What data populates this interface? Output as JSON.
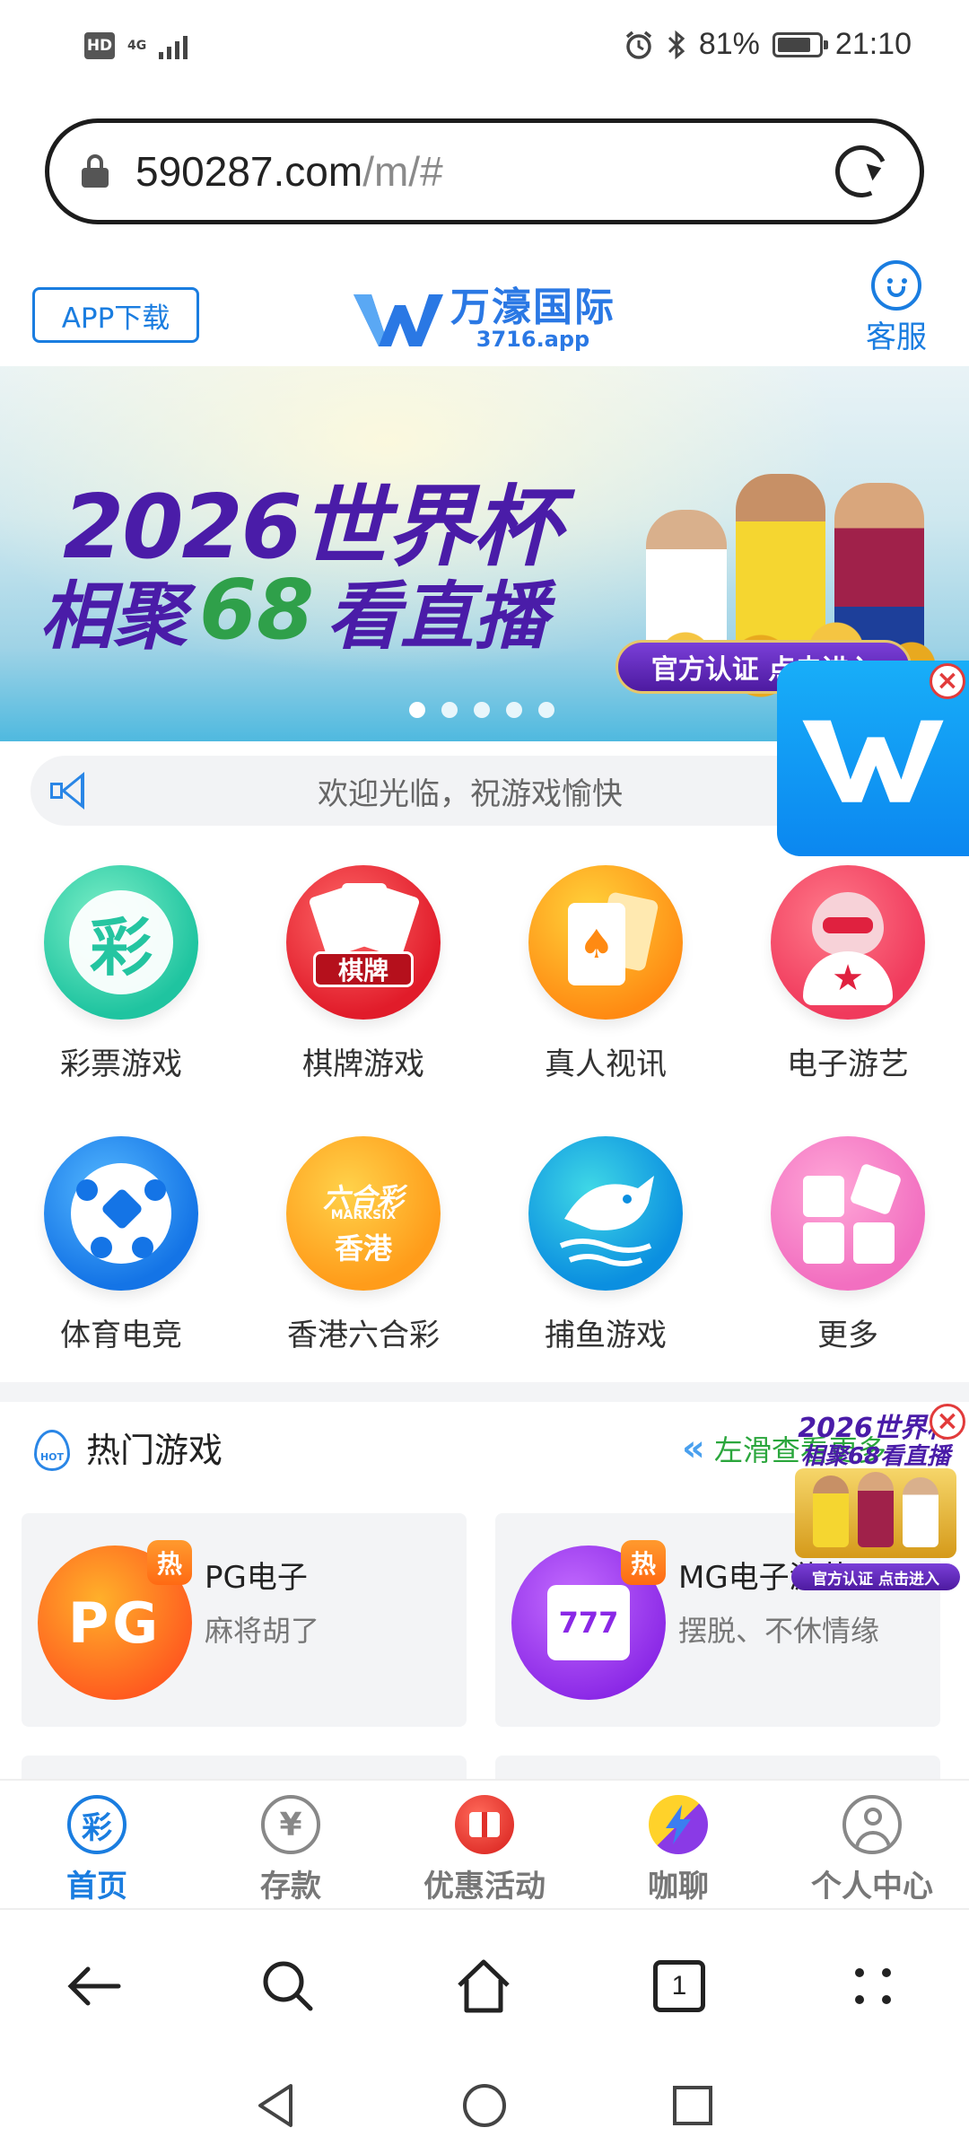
{
  "status_bar": {
    "hd": "HD",
    "network": "4G",
    "battery": "81%",
    "battery_level": 0.81,
    "time": "21:10"
  },
  "url_bar": {
    "domain": "590287.com",
    "path": "/m/#"
  },
  "header": {
    "app_download": "APP下载",
    "logo_name": "万濠国际",
    "logo_domain": "3716.app",
    "service_label": "客服"
  },
  "banner": {
    "line1": "2026世界杯",
    "line2_a": "相聚",
    "line2_num": "68",
    "line2_b": "看直播",
    "cta": "官方认证 点击进入",
    "slide_count": 5,
    "active_slide": 0
  },
  "notice": {
    "text": "欢迎光临，祝游戏愉快"
  },
  "categories": [
    {
      "label": "彩票游戏",
      "icon": "lottery-icon"
    },
    {
      "label": "棋牌游戏",
      "icon": "cards-icon"
    },
    {
      "label": "真人视讯",
      "icon": "live-casino-icon"
    },
    {
      "label": "电子游艺",
      "icon": "electronic-games-icon"
    },
    {
      "label": "体育电竞",
      "icon": "sports-icon"
    },
    {
      "label": "香港六合彩",
      "icon": "marksix-icon"
    },
    {
      "label": "捕鱼游戏",
      "icon": "fishing-icon"
    },
    {
      "label": "更多",
      "icon": "more-icon"
    }
  ],
  "category_icon_text": {
    "lottery": "彩",
    "cards": "棋牌",
    "marksix_top": "六合彩",
    "marksix_en": "MARKSIX",
    "marksix_bottom": "香港"
  },
  "hot_games": {
    "title": "热门游戏",
    "hot_icon_text": "HOT",
    "more_text": "左滑查看更多",
    "badge": "热",
    "games": [
      {
        "name": "PG电子",
        "desc": "麻将胡了",
        "logo_text": "PG"
      },
      {
        "name": "MG电子游艺",
        "desc": "摆脱、不休情缘",
        "logo_text": "777"
      }
    ]
  },
  "float_promo": {
    "line1": "2026世界杯",
    "line2": "相聚68看直播",
    "cta": "官方认证 点击进入"
  },
  "bottom_nav": [
    {
      "label": "首页",
      "icon": "home-lottery-icon",
      "icon_text": "彩",
      "active": true
    },
    {
      "label": "存款",
      "icon": "deposit-icon",
      "icon_text": "¥",
      "active": false
    },
    {
      "label": "优惠活动",
      "icon": "promotions-icon",
      "active": false
    },
    {
      "label": "咖聊",
      "icon": "chat-icon",
      "active": false
    },
    {
      "label": "个人中心",
      "icon": "profile-icon",
      "active": false
    }
  ],
  "browser_toolbar": {
    "tab_count": "1"
  },
  "colors": {
    "accent": "#1a7de0",
    "notice_bg": "#f2f3f5",
    "hot_more": "#2aa63c"
  }
}
